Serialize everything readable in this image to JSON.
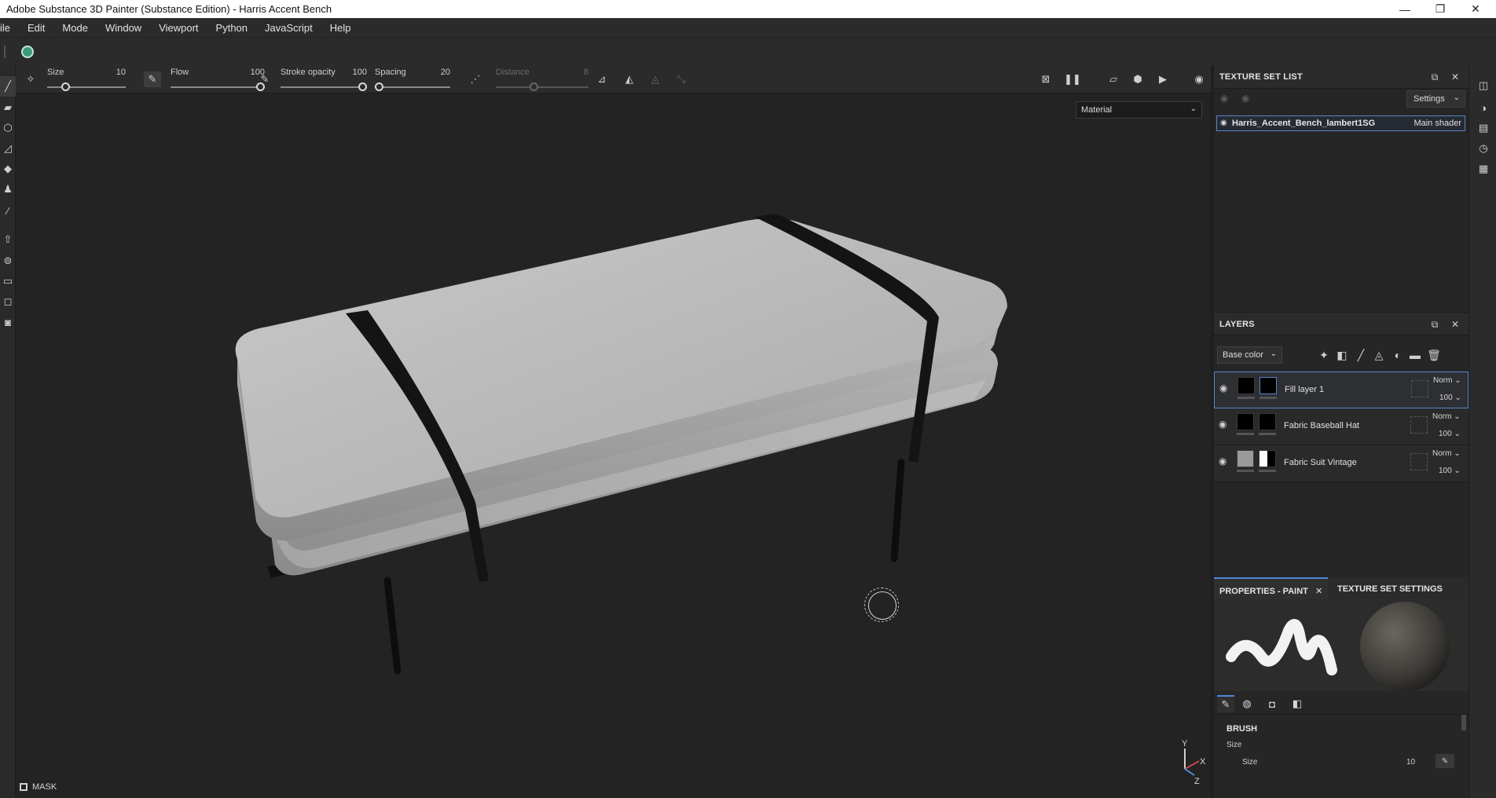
{
  "window": {
    "title": "Adobe Substance 3D Painter (Substance Edition) - Harris Accent Bench",
    "controls": [
      "—",
      "❐",
      "✕"
    ]
  },
  "menu": [
    "ile",
    "Edit",
    "Mode",
    "Window",
    "Viewport",
    "Python",
    "JavaScript",
    "Help"
  ],
  "paint_toolbar": {
    "size": {
      "label": "Size",
      "value": "10",
      "fraction": 0.2
    },
    "flow": {
      "label": "Flow",
      "value": "100",
      "fraction": 1.0
    },
    "stroke_opacity": {
      "label": "Stroke opacity",
      "value": "100",
      "fraction": 1.0
    },
    "spacing": {
      "label": "Spacing",
      "value": "20",
      "fraction": 0.0
    },
    "distance": {
      "label": "Distance",
      "value": "8",
      "fraction": 0.4
    }
  },
  "viewport": {
    "material_mode": "Material",
    "mask_label": "MASK",
    "axis": {
      "y": "Y",
      "x": "X",
      "z": "Z"
    }
  },
  "texture_set_list": {
    "title": "TEXTURE SET LIST",
    "settings_label": "Settings",
    "items": [
      {
        "name": "Harris_Accent_Bench_lambert1SG",
        "shader": "Main shader"
      }
    ]
  },
  "layers": {
    "title": "LAYERS",
    "channel": "Base color",
    "items": [
      {
        "name": "Fill layer 1",
        "blend": "Norm",
        "opacity": "100"
      },
      {
        "name": "Fabric Baseball Hat",
        "blend": "Norm",
        "opacity": "100"
      },
      {
        "name": "Fabric Suit Vintage",
        "blend": "Norm",
        "opacity": "100"
      }
    ]
  },
  "properties": {
    "tab_paint": "PROPERTIES - PAINT",
    "tab_tss": "TEXTURE SET SETTINGS",
    "section": "BRUSH",
    "subsection": "Size",
    "size_label": "Size",
    "size_value": "10"
  },
  "colors": {
    "accent_blue": "#5a83c7",
    "tab_blue": "#4f86d9",
    "logo_green": "#3e9a7a",
    "panel_bg": "#262626",
    "viewport_bg": "#232323"
  }
}
